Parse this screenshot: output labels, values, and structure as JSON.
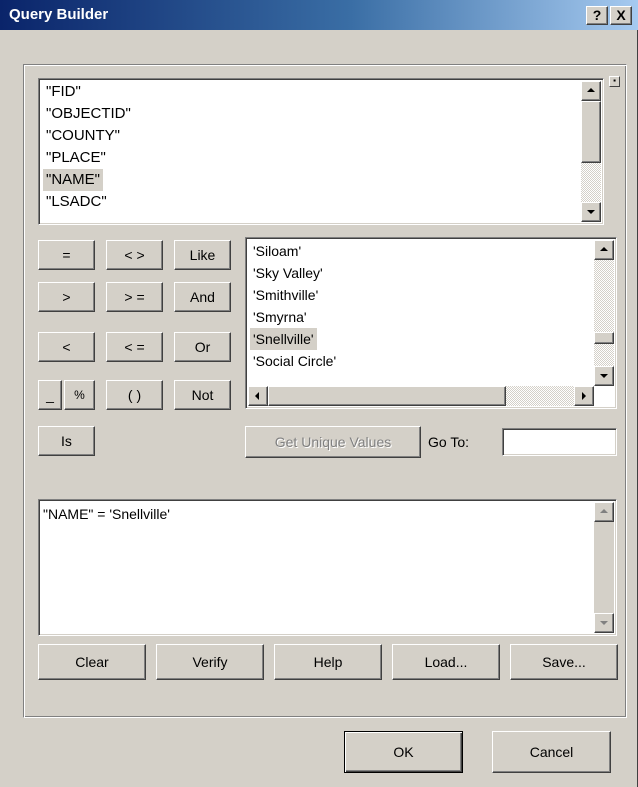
{
  "window": {
    "title": "Query Builder",
    "help_button": "?",
    "close_button": "X"
  },
  "fields_list": {
    "items": [
      "\"FID\"",
      "\"OBJECTID\"",
      "\"COUNTY\"",
      "\"PLACE\"",
      "\"NAME\"",
      "\"LSADC\""
    ],
    "selected": "\"NAME\""
  },
  "operators": {
    "eq": "=",
    "ne": "< >",
    "like": "Like",
    "gt": ">",
    "ge": "> =",
    "and": "And",
    "lt": "<",
    "le": "< =",
    "or": "Or",
    "underscore": "_",
    "percent": "%",
    "parens": "( )",
    "not": "Not",
    "is": "Is"
  },
  "values_list": {
    "items": [
      "'Siloam'",
      "'Sky Valley'",
      "'Smithville'",
      "'Smyrna'",
      "'Snellville'",
      "'Social Circle'"
    ],
    "selected": "'Snellville'"
  },
  "get_unique_values_button": "Get Unique Values",
  "go_to": {
    "label": "Go To:",
    "value": ""
  },
  "expression": {
    "text": "\"NAME\" = 'Snellville'"
  },
  "actions": {
    "clear": "Clear",
    "verify": "Verify",
    "help": "Help",
    "load": "Load...",
    "save": "Save..."
  },
  "footer": {
    "ok": "OK",
    "cancel": "Cancel"
  }
}
